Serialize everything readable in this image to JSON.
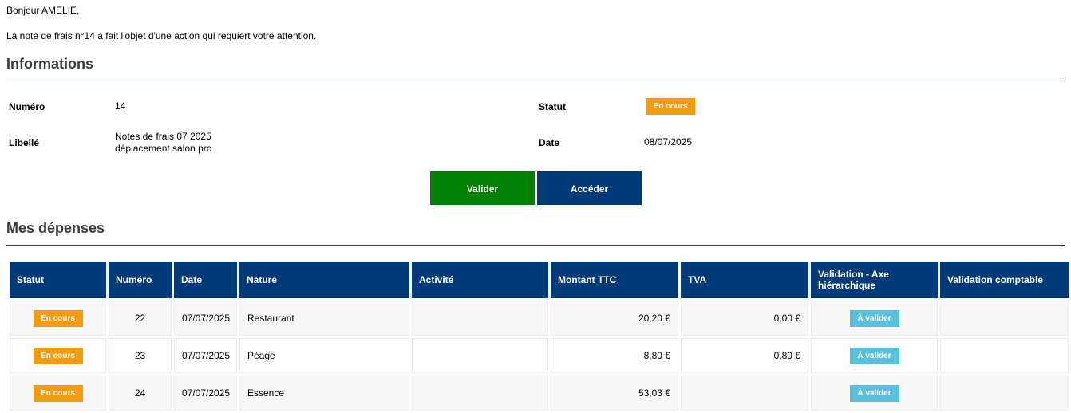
{
  "greeting": "Bonjour AMELIE,",
  "intro": "La note de frais n°14 a fait l'objet d'une action qui requiert votre attention.",
  "informations": {
    "title": "Informations",
    "numero_label": "Numéro",
    "numero_value": "14",
    "statut_label": "Statut",
    "statut_value": "En cours",
    "libelle_label": "Libellé",
    "libelle_line1": "Notes de frais 07 2025",
    "libelle_line2": "déplacement salon pro",
    "date_label": "Date",
    "date_value": "08/07/2025"
  },
  "actions": {
    "valider": "Valider",
    "acceder": "Accéder"
  },
  "depenses": {
    "title": "Mes dépenses",
    "headers": [
      "Statut",
      "Numéro",
      "Date",
      "Nature",
      "Activité",
      "Montant TTC",
      "TVA",
      "Validation - Axe hiérarchique",
      "Validation comptable"
    ],
    "rows": [
      {
        "statut": "En cours",
        "numero": "22",
        "date": "07/07/2025",
        "nature": "Restaurant",
        "activite": "",
        "montant": "20,20 €",
        "tva": "0,00 €",
        "validation_axe": "À valider",
        "validation_comptable": ""
      },
      {
        "statut": "En cours",
        "numero": "23",
        "date": "07/07/2025",
        "nature": "Péage",
        "activite": "",
        "montant": "8,80 €",
        "tva": "0,80 €",
        "validation_axe": "À valider",
        "validation_comptable": ""
      },
      {
        "statut": "En cours",
        "numero": "24",
        "date": "07/07/2025",
        "nature": "Essence",
        "activite": "",
        "montant": "53,03 €",
        "tva": "",
        "validation_axe": "À valider",
        "validation_comptable": ""
      }
    ]
  },
  "colors": {
    "navy": "#003a78",
    "green": "#008000",
    "orange": "#f39c12",
    "light_blue": "#5bc0de"
  }
}
